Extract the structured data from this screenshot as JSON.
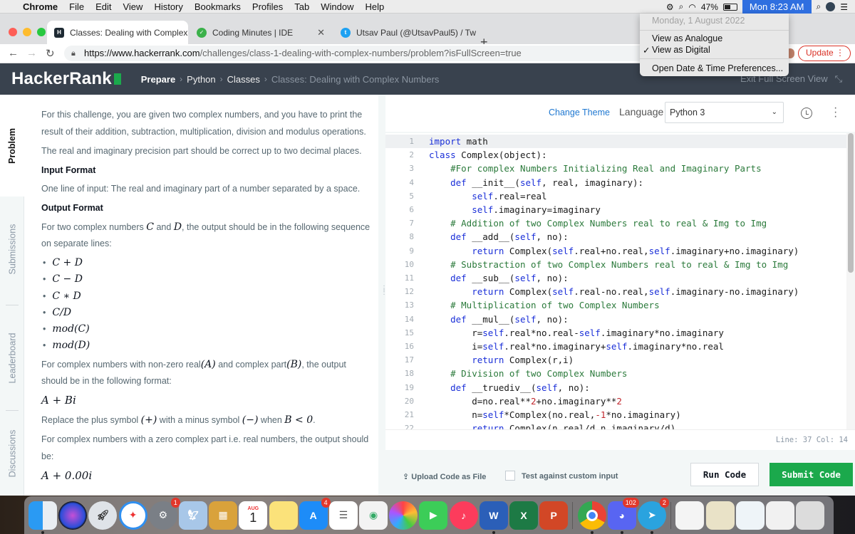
{
  "menubar": {
    "app": "Chrome",
    "items": [
      "File",
      "Edit",
      "View",
      "History",
      "Bookmarks",
      "Profiles",
      "Tab",
      "Window",
      "Help"
    ],
    "battery": "47%",
    "clock": "Mon 8:23 AM"
  },
  "clock_menu": {
    "date": "Monday, 1 August 2022",
    "analogue": "View as Analogue",
    "digital": "View as Digital",
    "checkmark": "✓",
    "prefs": "Open Date & Time Preferences..."
  },
  "tabs": [
    {
      "title": "Classes: Dealing with Complex",
      "favicon_text": "H"
    },
    {
      "title": "Coding Minutes | IDE"
    },
    {
      "title": "Utsav Paul (@UtsavPaul5) / Tw"
    }
  ],
  "address": {
    "host": "https://www.hackerrank.com",
    "path": "/challenges/class-1-dealing-with-complex-numbers/problem?isFullScreen=true"
  },
  "update_label": "Update",
  "hr": {
    "logo": "HackerRank",
    "breadcrumbs": [
      "Prepare",
      "Python",
      "Classes",
      "Classes: Dealing with Complex Numbers"
    ],
    "exit": "Exit Full Screen View"
  },
  "rail": [
    "Problem",
    "Submissions",
    "Leaderboard",
    "Discussions"
  ],
  "problem": {
    "p1": "For this challenge, you are given two complex numbers, and you have to print the result of their addition, subtraction, multiplication, division and modulus operations.",
    "p2": "The real and imaginary precision part should be correct up to two decimal places.",
    "h_input": "Input Format",
    "p3": "One line of input: The real and imaginary part of a number separated by a space.",
    "h_output": "Output Format",
    "p4a": "For two complex numbers ",
    "C": "C",
    "p4b": " and ",
    "D": "D",
    "p4c": ", the output should be in the following sequence on separate lines:",
    "ops": [
      "C + D",
      "C − D",
      "C ∗ D",
      "C/D",
      "mod(C)",
      "mod(D)"
    ],
    "p5a": "For complex numbers with non-zero real",
    "A_par": "(A)",
    "p5b": " and complex part",
    "B_par": "(B)",
    "p5c": ", the output should be in the following format:",
    "fmt1": "A + Bi",
    "p6a": "Replace the plus symbol ",
    "plus": "(+)",
    "p6b": " with a minus symbol ",
    "minus": "(−)",
    "p6c": " when ",
    "cond": "B < 0",
    "p6d": ".",
    "p7": "For complex numbers with a zero complex part i.e. real numbers, the output should be:",
    "fmt2": "A + 0.00i"
  },
  "editor": {
    "change_theme": "Change Theme",
    "language_label": "Language",
    "language": "Python 3",
    "lines": [
      "1",
      "2",
      "3",
      "4",
      "5",
      "6",
      "7",
      "8",
      "9",
      "10",
      "11",
      "12",
      "13",
      "14",
      "15",
      "16",
      "17",
      "18",
      "19",
      "20",
      "21",
      "22"
    ],
    "status": "Line: 37 Col: 14",
    "upload": "Upload Code as File",
    "custom_input": "Test against custom input",
    "run": "Run Code",
    "submit": "Submit Code"
  },
  "dock": {
    "badges": {
      "settings": "1",
      "calendar_month": "AUG",
      "calendar_day": "1",
      "appstore": "4",
      "discord": "102",
      "telegram": "2"
    }
  }
}
